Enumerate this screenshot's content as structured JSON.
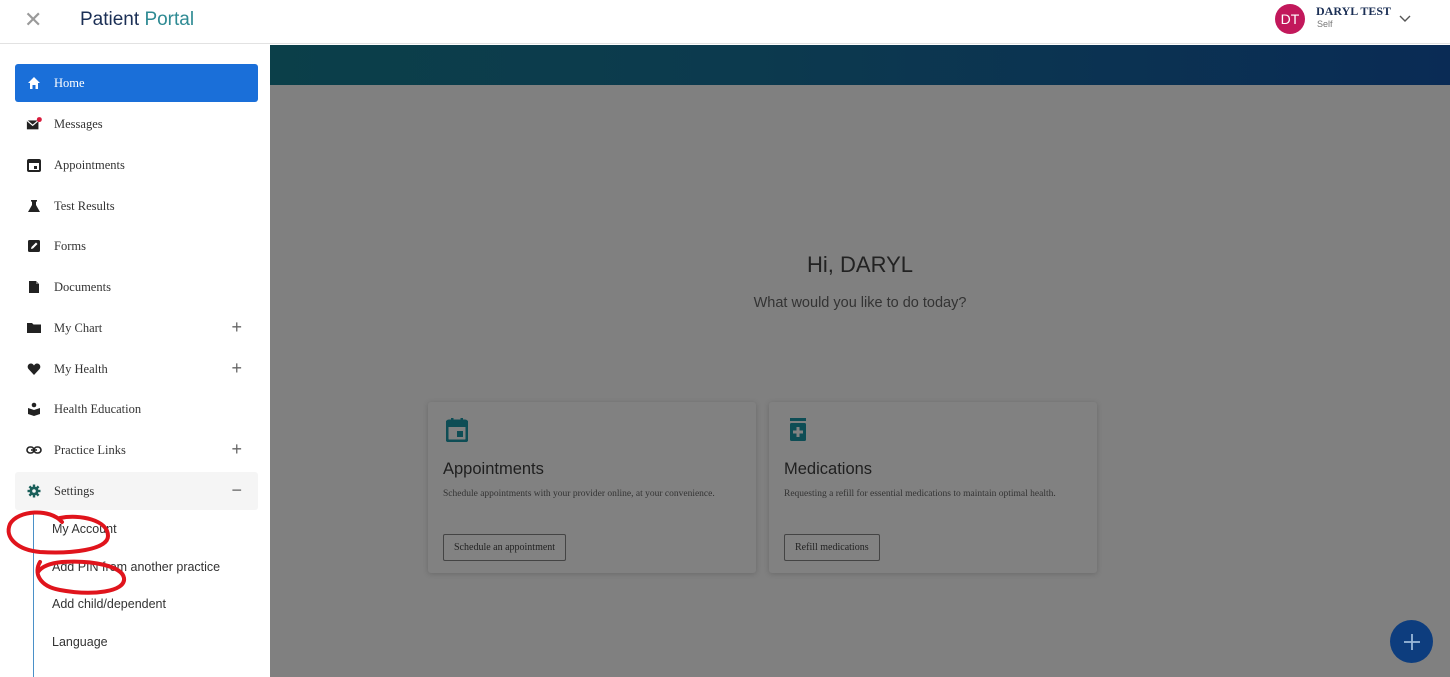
{
  "header": {
    "brand_part1": "Patient",
    "brand_part2": "Portal",
    "avatar_initials": "DT",
    "user_name": "DARYL TEST",
    "user_role": "Self"
  },
  "sidebar": {
    "items": [
      {
        "label": "Home",
        "icon": "home-icon"
      },
      {
        "label": "Messages",
        "icon": "envelope-icon"
      },
      {
        "label": "Appointments",
        "icon": "calendar-icon"
      },
      {
        "label": "Test Results",
        "icon": "flask-icon"
      },
      {
        "label": "Forms",
        "icon": "edit-icon"
      },
      {
        "label": "Documents",
        "icon": "document-icon"
      },
      {
        "label": "My Chart",
        "icon": "folder-icon",
        "expand": "+"
      },
      {
        "label": "My Health",
        "icon": "heart-icon",
        "expand": "+"
      },
      {
        "label": "Health Education",
        "icon": "education-icon"
      },
      {
        "label": "Practice Links",
        "icon": "link-icon",
        "expand": "+"
      },
      {
        "label": "Settings",
        "icon": "gear-icon",
        "expand": "−"
      }
    ],
    "settings_subitems": [
      "My Account",
      "Add PIN from another practice",
      "Add child/dependent",
      "Language"
    ]
  },
  "main": {
    "greeting": "Hi, DARYL",
    "subtitle": "What would you like to do today?",
    "cards": [
      {
        "title": "Appointments",
        "description": "Schedule appointments with your provider online, at your convenience.",
        "button": "Schedule an appointment",
        "icon": "calendar-icon"
      },
      {
        "title": "Medications",
        "description": "Requesting a refill for essential medications to maintain optimal health.",
        "button": "Refill medications",
        "icon": "medication-icon"
      }
    ],
    "fab_label": "+"
  },
  "colors": {
    "accent_blue": "#1a6fd9",
    "brand_navy": "#1b2f55",
    "brand_teal": "#2e8a93",
    "avatar_bg": "#c2185b",
    "card_icon": "#0e4d55",
    "annotation_red": "#e0141c"
  }
}
